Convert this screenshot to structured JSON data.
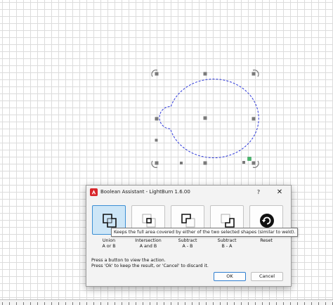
{
  "dialog": {
    "title": "Boolean Assistant - LightBurn 1.6.00",
    "help_label": "?",
    "close_label": "✕",
    "operations": [
      {
        "line1": "Union",
        "line2": "A or B",
        "icon": "union-icon",
        "active": true
      },
      {
        "line1": "Intersection",
        "line2": "A and B",
        "icon": "intersection-icon",
        "active": false
      },
      {
        "line1": "Subtract",
        "line2": "A - B",
        "icon": "subtract-a-b-icon",
        "active": false
      },
      {
        "line1": "Subtract",
        "line2": "B - A",
        "icon": "subtract-b-a-icon",
        "active": false
      },
      {
        "line1": "Reset",
        "line2": "",
        "icon": "reset-icon",
        "active": false
      }
    ],
    "tooltip": "Keeps the full area covered by either of the two selected shapes (similar to weld).",
    "instructions": [
      "Press a button to view the action.",
      "Press 'Ok' to keep the result, or 'Cancel' to discard it."
    ],
    "ok_label": "OK",
    "cancel_label": "Cancel"
  },
  "colors": {
    "shape_outline": "#2b36d9",
    "handle": "#7a7a7a",
    "selection_accent": "#44b86a",
    "button_active_bg": "#cde6f7",
    "button_active_border": "#3c8fd4",
    "app_icon_red": "#d8262b"
  }
}
